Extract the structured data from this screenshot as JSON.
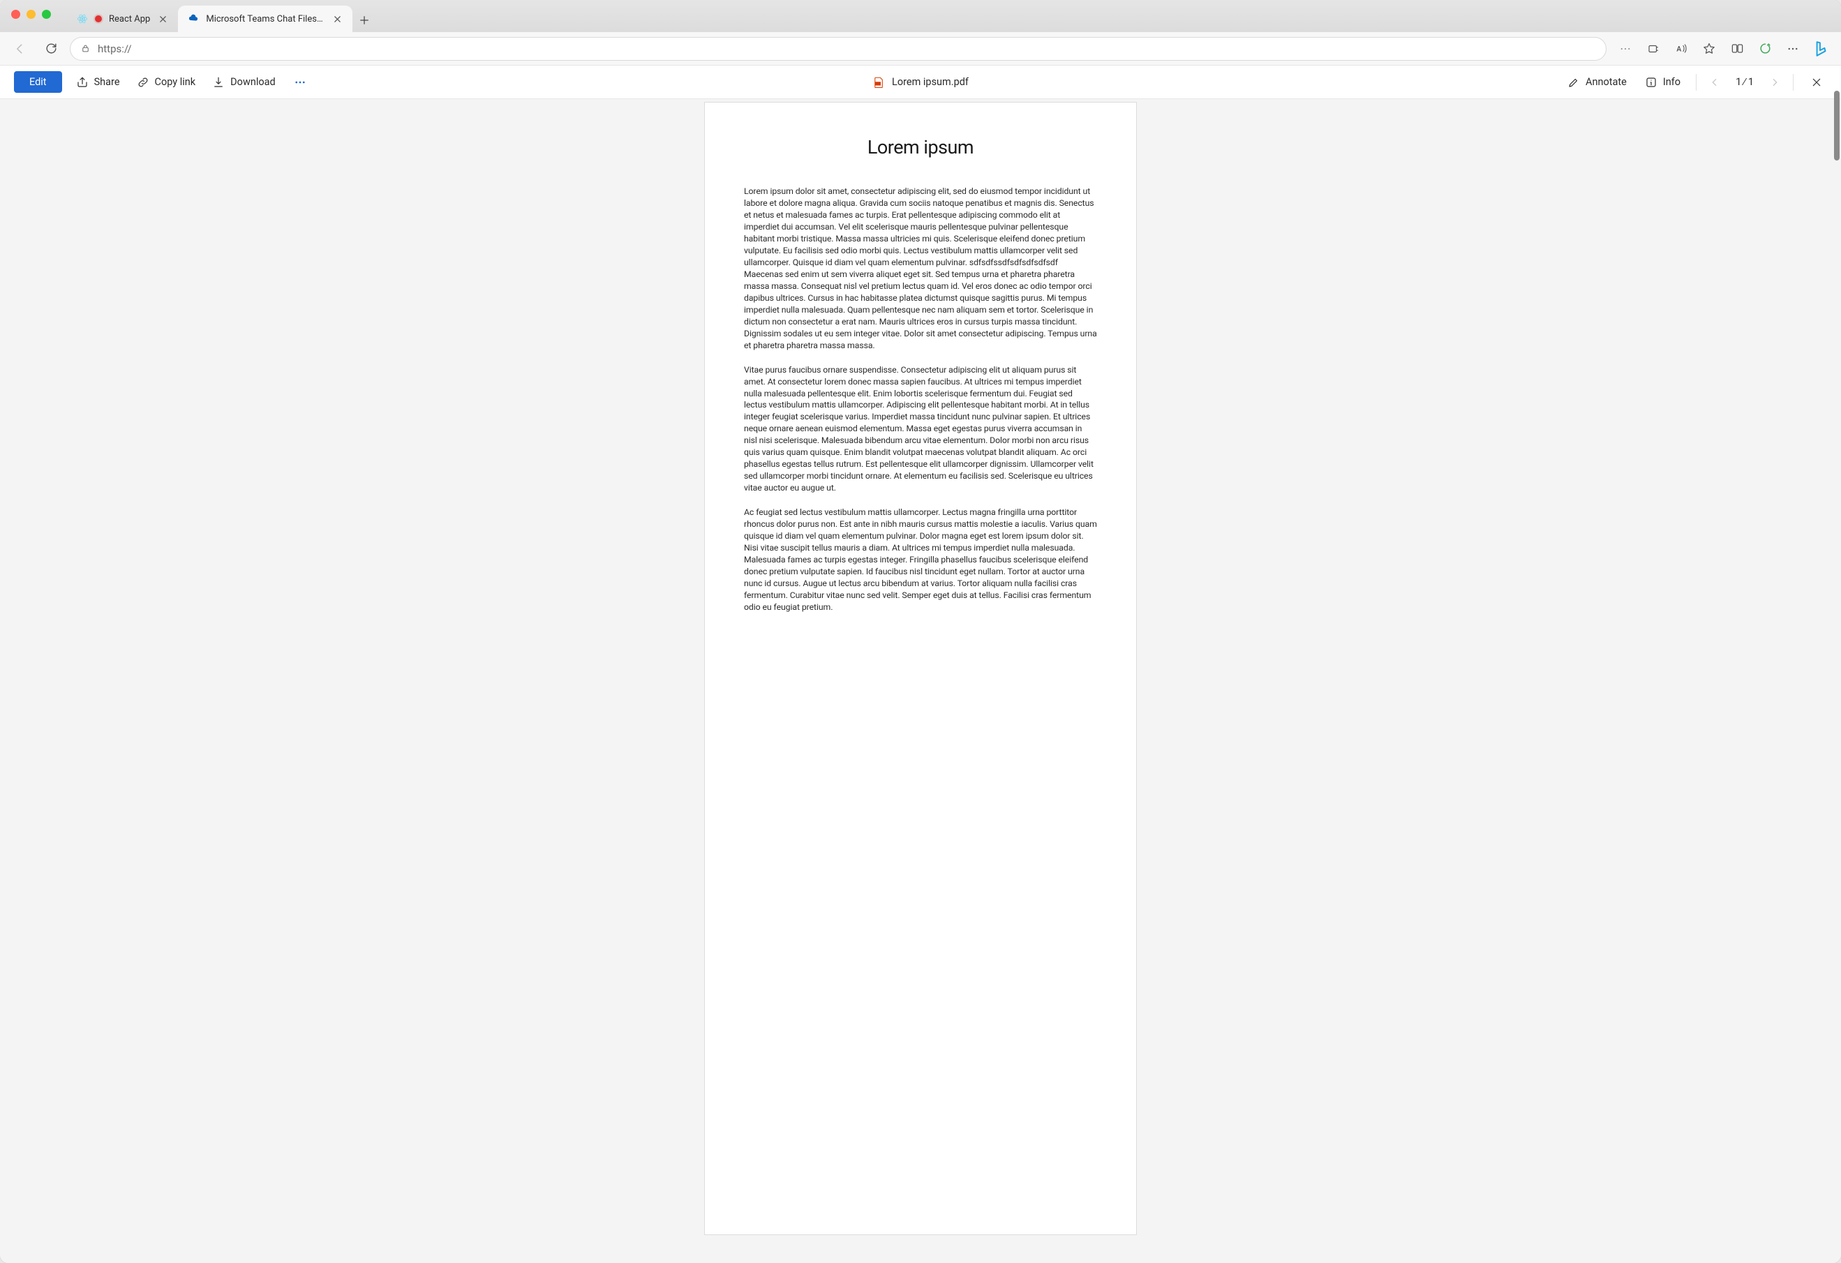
{
  "browser": {
    "tabs": [
      {
        "title": "React App",
        "active": false
      },
      {
        "title": "Microsoft Teams Chat Files - O",
        "active": true
      }
    ],
    "url": "https://"
  },
  "toolbar": {
    "edit": "Edit",
    "share": "Share",
    "copy_link": "Copy link",
    "download": "Download",
    "annotate": "Annotate",
    "info": "Info",
    "page_indicator": "1 ∕ 1",
    "doc_title": "Lorem ipsum.pdf"
  },
  "document": {
    "heading": "Lorem ipsum",
    "paragraphs": [
      "Lorem ipsum dolor sit amet, consectetur adipiscing elit, sed do eiusmod tempor incididunt ut labore et dolore magna aliqua. Gravida cum sociis natoque penatibus et magnis dis. Senectus et netus et malesuada fames ac turpis. Erat pellentesque adipiscing commodo elit at imperdiet dui accumsan. Vel elit scelerisque mauris pellentesque pulvinar pellentesque habitant morbi tristique. Massa massa ultricies mi quis. Scelerisque eleifend donec pretium vulputate. Eu facilisis sed odio morbi quis. Lectus vestibulum mattis ullamcorper velit sed ullamcorper. Quisque id diam vel quam elementum pulvinar. sdfsdfssdfsdfsdfsdfsdf",
      "Maecenas sed enim ut sem viverra aliquet eget sit. Sed tempus urna et pharetra pharetra massa massa. Consequat nisl vel pretium lectus quam id. Vel eros donec ac odio tempor orci dapibus ultrices. Cursus in hac habitasse platea dictumst quisque sagittis purus. Mi tempus imperdiet nulla malesuada. Quam pellentesque nec nam aliquam sem et tortor. Scelerisque in dictum non consectetur a erat nam. Mauris ultrices eros in cursus turpis massa tincidunt. Dignissim sodales ut eu sem integer vitae. Dolor sit amet consectetur adipiscing. Tempus urna et pharetra pharetra massa massa.",
      "Vitae purus faucibus ornare suspendisse. Consectetur adipiscing elit ut aliquam purus sit amet. At consectetur lorem donec massa sapien faucibus. At ultrices mi tempus imperdiet nulla malesuada pellentesque elit. Enim lobortis scelerisque fermentum dui. Feugiat sed lectus vestibulum mattis ullamcorper. Adipiscing elit pellentesque habitant morbi. At in tellus integer feugiat scelerisque varius. Imperdiet massa tincidunt nunc pulvinar sapien. Et ultrices neque ornare aenean euismod elementum. Massa eget egestas purus viverra accumsan in nisl nisi scelerisque. Malesuada bibendum arcu vitae elementum. Dolor morbi non arcu risus quis varius quam quisque. Enim blandit volutpat maecenas volutpat blandit aliquam. Ac orci phasellus egestas tellus rutrum. Est pellentesque elit ullamcorper dignissim. Ullamcorper velit sed ullamcorper morbi tincidunt ornare. At elementum eu facilisis sed. Scelerisque eu ultrices vitae auctor eu augue ut.",
      "Ac feugiat sed lectus vestibulum mattis ullamcorper. Lectus magna fringilla urna porttitor rhoncus dolor purus non. Est ante in nibh mauris cursus mattis molestie a iaculis. Varius quam quisque id diam vel quam elementum pulvinar. Dolor magna eget est lorem ipsum dolor sit. Nisi vitae suscipit tellus mauris a diam. At ultrices mi tempus imperdiet nulla malesuada. Malesuada fames ac turpis egestas integer. Fringilla phasellus faucibus scelerisque eleifend donec pretium vulputate sapien. Id faucibus nisl tincidunt eget nullam. Tortor at auctor urna nunc id cursus. Augue ut lectus arcu bibendum at varius. Tortor aliquam nulla facilisi cras fermentum. Curabitur vitae nunc sed velit. Semper eget duis at tellus. Facilisi cras fermentum odio eu feugiat pretium."
    ]
  },
  "colors": {
    "primary": "#2169d3",
    "text": "#2b2b2b",
    "bg_page": "#ffffff",
    "bg_canvas": "#f4f4f4"
  }
}
